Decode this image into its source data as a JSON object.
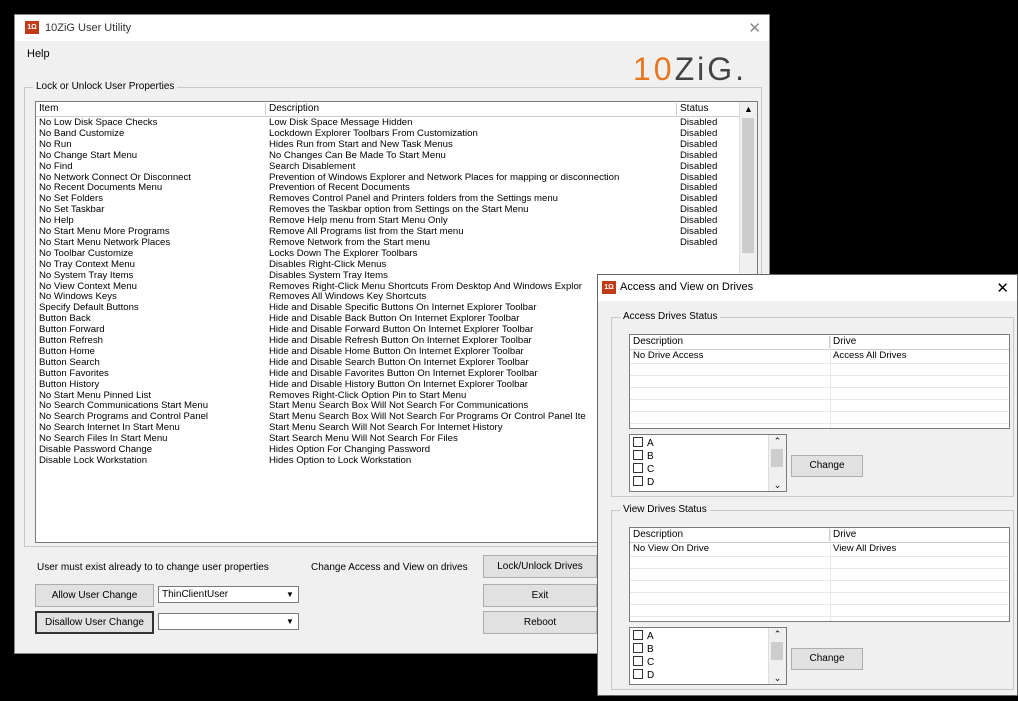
{
  "main": {
    "title": "10ZiG User Utility",
    "menu_help": "Help",
    "brand": {
      "one": "10",
      "rest": "ZiG."
    },
    "group_label": "Lock or Unlock User Properties",
    "columns": {
      "item": "Item",
      "description": "Description",
      "status": "Status"
    },
    "rows": [
      {
        "item": "No Low Disk Space Checks",
        "description": "Low Disk Space Message Hidden",
        "status": "Disabled"
      },
      {
        "item": "No Band Customize",
        "description": "Lockdown Explorer Toolbars From Customization",
        "status": "Disabled"
      },
      {
        "item": "No Run",
        "description": "Hides Run from Start and New Task Menus",
        "status": "Disabled"
      },
      {
        "item": "No Change Start Menu",
        "description": "No Changes Can Be Made To Start Menu",
        "status": "Disabled"
      },
      {
        "item": "No Find",
        "description": "Search Disablement",
        "status": "Disabled"
      },
      {
        "item": "No Network Connect Or Disconnect",
        "description": "Prevention of Windows Explorer and Network Places for mapping or disconnection",
        "status": "Disabled"
      },
      {
        "item": "No Recent Documents Menu",
        "description": "Prevention of Recent Documents",
        "status": "Disabled"
      },
      {
        "item": "No Set Folders",
        "description": "Removes Control Panel and Printers folders from the Settings menu",
        "status": "Disabled"
      },
      {
        "item": "No Set Taskbar",
        "description": "Removes the Taskbar option from Settings on the Start Menu",
        "status": "Disabled"
      },
      {
        "item": "No Help",
        "description": "Remove Help menu from Start Menu Only",
        "status": "Disabled"
      },
      {
        "item": "No Start Menu More Programs",
        "description": "Remove All Programs list from the Start menu",
        "status": "Disabled"
      },
      {
        "item": "No Start Menu Network Places",
        "description": "Remove Network from the Start menu",
        "status": "Disabled"
      },
      {
        "item": "No Toolbar Customize",
        "description": "Locks Down The Explorer Toolbars",
        "status": ""
      },
      {
        "item": "No Tray Context Menu",
        "description": "Disables Right-Click Menus",
        "status": ""
      },
      {
        "item": "No System Tray Items",
        "description": "Disables System Tray Items",
        "status": ""
      },
      {
        "item": "No View Context Menu",
        "description": "Removes Right-Click Menu Shortcuts From Desktop And Windows Explor",
        "status": ""
      },
      {
        "item": "No Windows Keys",
        "description": "Removes All Windows Key Shortcuts",
        "status": ""
      },
      {
        "item": "Specify Default Buttons",
        "description": "Hide and Disable Specific Buttons On Internet Explorer Toolbar",
        "status": ""
      },
      {
        "item": "Button Back",
        "description": "Hide and Disable Back Button On Internet Explorer Toolbar",
        "status": ""
      },
      {
        "item": "Button Forward",
        "description": "Hide and Disable Forward Button On Internet Explorer Toolbar",
        "status": ""
      },
      {
        "item": "Button Refresh",
        "description": "Hide and Disable Refresh Button On Internet Explorer Toolbar",
        "status": ""
      },
      {
        "item": "Button Home",
        "description": "Hide and Disable Home Button On Internet Explorer Toolbar",
        "status": ""
      },
      {
        "item": "Button Search",
        "description": "Hide and Disable Search Button On Internet Explorer Toolbar",
        "status": ""
      },
      {
        "item": "Button Favorites",
        "description": "Hide and Disable Favorites Button On Internet Explorer Toolbar",
        "status": ""
      },
      {
        "item": "Button History",
        "description": "Hide and Disable History Button On Internet Explorer Toolbar",
        "status": ""
      },
      {
        "item": "No Start Menu Pinned List",
        "description": "Removes Right-Click Option Pin to Start Menu",
        "status": ""
      },
      {
        "item": "No Search Communications Start Menu",
        "description": "Start Menu Search Box Will Not Search For Communications",
        "status": ""
      },
      {
        "item": "No Search Programs and Control Panel",
        "description": "Start Menu Search Box Will Not Search For Programs Or Control Panel Ite",
        "status": ""
      },
      {
        "item": "No Search Internet In Start Menu",
        "description": "Start Menu Search Will Not Search For Internet History",
        "status": ""
      },
      {
        "item": "No Search Files In Start Menu",
        "description": "Start Search Menu Will Not Search For Files",
        "status": ""
      },
      {
        "item": "Disable Password Change",
        "description": "Hides Option For Changing Password",
        "status": ""
      },
      {
        "item": "Disable Lock Workstation",
        "description": "Hides Option to Lock Workstation",
        "status": ""
      }
    ],
    "user_note": "User must exist already to to change user properties",
    "access_label": "Change Access and View on drives",
    "lock_unlock_button": "Lock/Unlock Drives",
    "allow_button": "Allow User Change",
    "allow_combo_value": "ThinClientUser",
    "disallow_button": "Disallow User Change",
    "disallow_combo_value": "",
    "exit_button": "Exit",
    "reboot_button": "Reboot"
  },
  "drives": {
    "title": "Access and View on Drives",
    "access": {
      "group_label": "Access Drives Status",
      "columns": {
        "description": "Description",
        "drive": "Drive"
      },
      "row": {
        "description": "No Drive Access",
        "drive": "Access All Drives"
      },
      "letters": [
        "A",
        "B",
        "C",
        "D"
      ],
      "change_button": "Change"
    },
    "view": {
      "group_label": "View Drives Status",
      "columns": {
        "description": "Description",
        "drive": "Drive"
      },
      "row": {
        "description": "No View On Drive",
        "drive": "View All Drives"
      },
      "letters": [
        "A",
        "B",
        "C",
        "D"
      ],
      "change_button": "Change"
    }
  },
  "icons": {
    "app": "10zig-logo-icon",
    "close": "close-icon",
    "dropdown": "chevron-down-icon",
    "scroll_up": "scroll-up-icon"
  },
  "colors": {
    "brand_orange": "#e87722",
    "logo_red": "#c13a16",
    "window_bg": "#f0f0f0"
  }
}
